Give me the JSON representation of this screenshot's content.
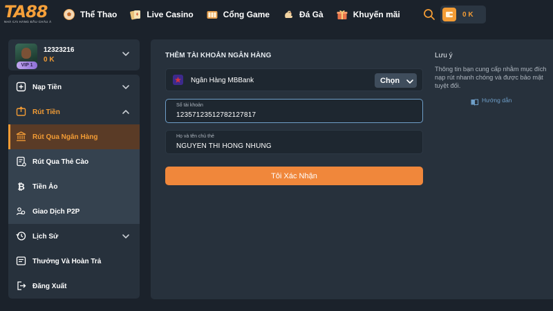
{
  "header": {
    "logo_text": "TA88",
    "logo_tagline": "NHÀ CÁI HÀNG ĐẦU CHÂU Á",
    "nav": [
      {
        "label": "Thể Thao",
        "icon": "soccer-ball-icon"
      },
      {
        "label": "Live Casino",
        "icon": "playing-cards-icon"
      },
      {
        "label": "Cổng Game",
        "icon": "game-portal-icon"
      },
      {
        "label": "Đá Gà",
        "icon": "rooster-icon"
      },
      {
        "label": "Khuyến mãi",
        "icon": "gift-icon"
      }
    ],
    "wallet_amount": "0 K"
  },
  "user": {
    "username": "12323216",
    "balance": "0 K",
    "vip": "VIP 1"
  },
  "sidebar": {
    "items": [
      {
        "label": "Nạp Tiền",
        "icon": "deposit-icon"
      },
      {
        "label": "Rút Tiền",
        "icon": "withdraw-icon"
      },
      {
        "label": "Rút Qua Ngân Hàng",
        "icon": "bank-icon"
      },
      {
        "label": "Rút Qua Thẻ Cào",
        "icon": "scratch-card-icon"
      },
      {
        "label": "Tiền Ảo",
        "icon": "bitcoin-icon"
      },
      {
        "label": "Giao Dịch P2P",
        "icon": "p2p-icon"
      },
      {
        "label": "Lịch Sử",
        "icon": "history-icon"
      },
      {
        "label": "Thưởng Và Hoàn Trả",
        "icon": "reward-icon"
      },
      {
        "label": "Đăng Xuất",
        "icon": "logout-icon"
      }
    ]
  },
  "form": {
    "title": "THÊM TÀI KHOẢN NGÂN HÀNG",
    "bank_name": "Ngân Hàng MBBank",
    "choose_label": "Chọn",
    "account_number_label": "Số tài khoản",
    "account_number": "12357123512782127817",
    "holder_label": "Họ và tên chủ thẻ",
    "holder_name": "NGUYEN THI HONG NHUNG",
    "confirm_label": "Tôi Xác Nhận"
  },
  "note": {
    "title": "Lưu ý",
    "text": "Thông tin bạn cung cấp nhằm mục đích nạp rút nhanh chóng và được bảo mật tuyệt đối.",
    "guide_label": "Hướng dẫn"
  },
  "colors": {
    "accent": "#f39c35",
    "button": "#f0873b",
    "link": "#6f9fc9",
    "panel": "#27313c",
    "background": "#1b222b"
  }
}
